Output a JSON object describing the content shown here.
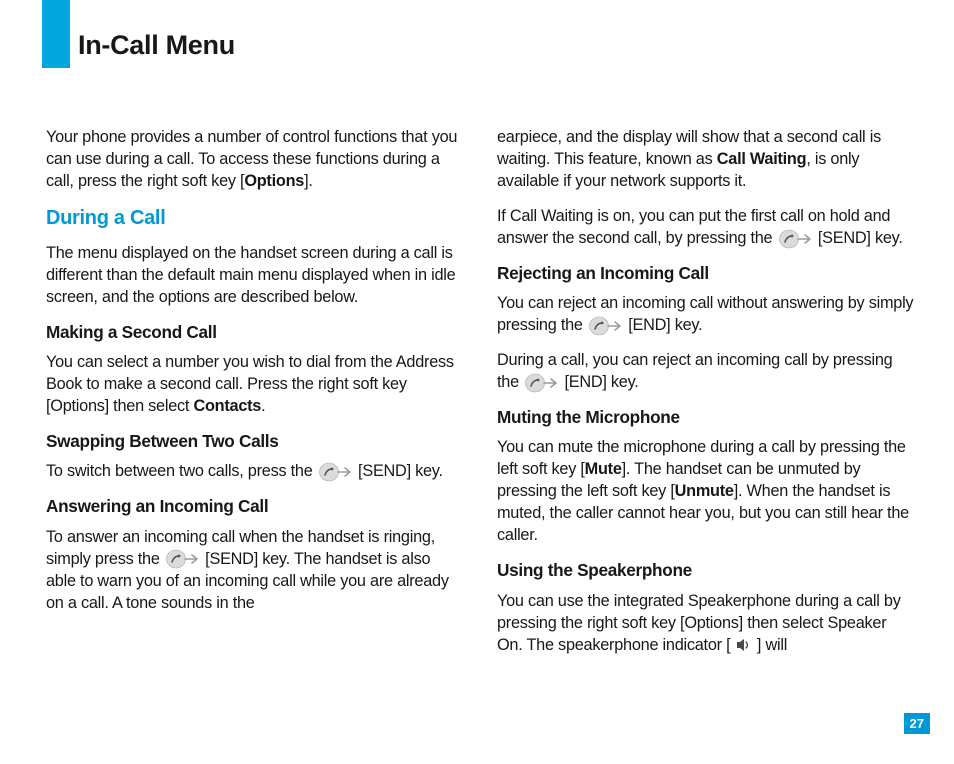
{
  "page_title": "In-Call Menu",
  "page_number": "27",
  "col1": {
    "intro_a": "Your phone provides a number of control functions that you can use during a call. To access these functions during a call, press the right soft key [",
    "intro_bold": "Options",
    "intro_b": "].",
    "during_heading": "During a Call",
    "during_text": "The menu displayed on the handset screen during a call is different than the default main menu displayed when in idle screen, and the options are described below.",
    "second_heading": "Making a Second Call",
    "second_a": "You can select a number you wish to dial from the Address Book to make a second call. Press the right soft key [Options] then select ",
    "second_bold": "Contacts",
    "second_b": ".",
    "swap_heading": "Swapping Between Two Calls",
    "swap_a": "To switch between two calls, press the ",
    "swap_b": " [SEND] key.",
    "answer_heading": "Answering an Incoming Call",
    "answer_a": "To answer an incoming call when the handset is ringing, simply press the ",
    "answer_b": " [SEND] key. The handset is also able to warn you of an incoming call while you are already on a call. A tone sounds in the"
  },
  "col2": {
    "waiting_a": "earpiece, and the display will show that a second call is waiting. This feature, known as ",
    "waiting_bold": "Call Waiting",
    "waiting_b": ", is only available if your network supports it.",
    "waiting2_a": "If Call Waiting is on, you can put the first call on hold and answer the second call, by pressing the ",
    "waiting2_b": " [SEND] key.",
    "reject_heading": "Rejecting an Incoming Call",
    "reject_a": "You can reject an incoming call without answering by simply pressing the ",
    "reject_b": " [END] key.",
    "reject2_a": "During a call, you can reject an incoming call by pressing the ",
    "reject2_b": " [END] key.",
    "mute_heading": "Muting the Microphone",
    "mute_a": "You can mute the microphone during a call by pressing the left soft key [",
    "mute_bold1": "Mute",
    "mute_b": "]. The handset can be unmuted by pressing the left soft key [",
    "mute_bold2": "Unmute",
    "mute_c": "]. When the handset is muted, the caller cannot hear you, but you can still hear the caller.",
    "speaker_heading": "Using the Speakerphone",
    "speaker_a": "You can use the integrated Speakerphone during a call by pressing the right soft key [Options] then select Speaker On. The speakerphone indicator [ ",
    "speaker_b": " ] will"
  }
}
